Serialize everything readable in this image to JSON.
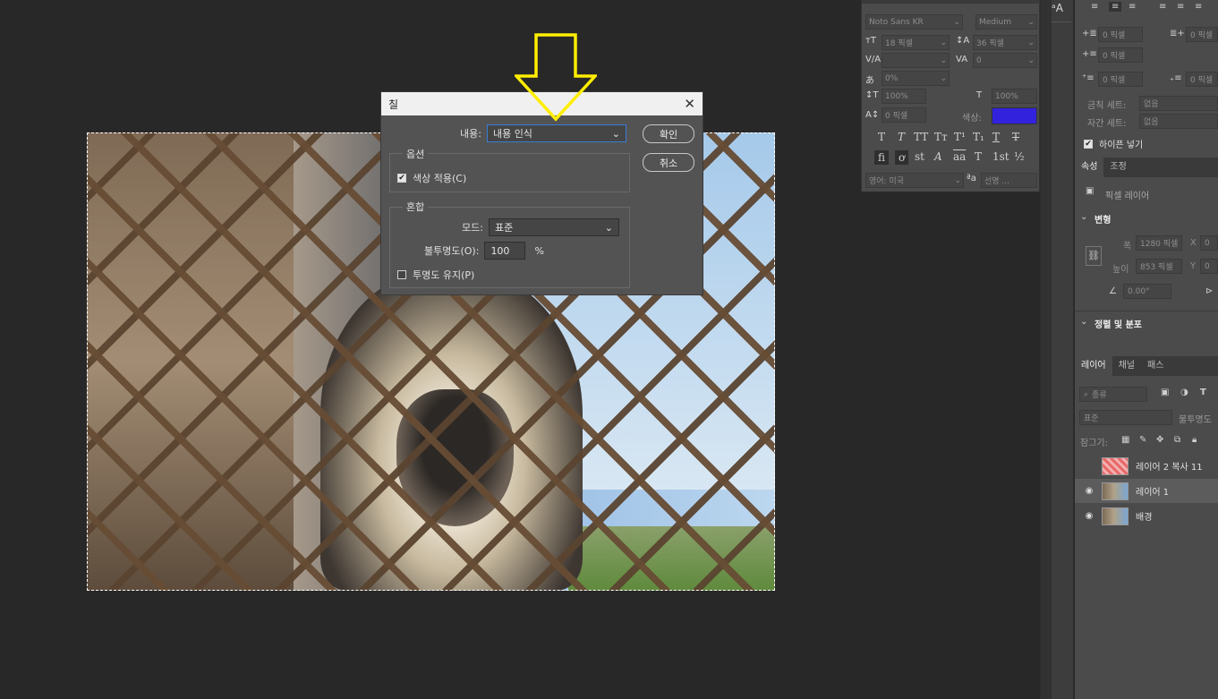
{
  "dialog": {
    "title": "칠",
    "close_glyph": "✕",
    "content_label": "내용:",
    "content_value": "내용 인식",
    "ok_label": "확인",
    "cancel_label": "취소",
    "options_label": "옵션",
    "color_adapt_label": "색상 적용(C)",
    "color_adapt_checked": true,
    "blend_label": "혼합",
    "mode_label": "모드:",
    "mode_value": "표준",
    "opacity_label": "불투명도(O):",
    "opacity_value": "100",
    "opacity_unit": "%",
    "preserve_label": "투명도 유지(P)",
    "preserve_checked": false
  },
  "character": {
    "font_family": "Noto Sans KR",
    "font_style": "Medium",
    "size": "18 픽셀",
    "leading": "36 픽셀",
    "kerning": "",
    "tracking": "0",
    "tsume": "0%",
    "vscale": "100%",
    "hscale": "100%",
    "baseline": "0 픽셀",
    "color_label": "색상:",
    "color_hex": "#3322dd",
    "language": "영어: 미국",
    "antialias": "선명 ...",
    "aa_glyph": "ªa"
  },
  "paragraph": {
    "indent_left": "0 픽셀",
    "indent_right": "0 픽셀",
    "indent_first": "0 픽셀",
    "space_before": "0 픽셀",
    "space_after": "0 픽셀",
    "kinsoku_label": "금칙 세트:",
    "kinsoku_value": "없음",
    "mojikumi_label": "자간 세트:",
    "mojikumi_value": "없음",
    "hyphenate_label": "하이픈 넣기",
    "hyphenate_checked": true
  },
  "properties": {
    "tab_properties": "속성",
    "tab_adjust": "조정",
    "pixel_layer_label": "픽셀 레이어",
    "transform_label": "변형",
    "width_label": "폭",
    "width_value": "1280 픽셀",
    "height_label": "높이",
    "height_value": "853 픽셀",
    "x_label": "X",
    "x_value": "0",
    "y_label": "Y",
    "y_value": "0",
    "angle_value": "0.00°",
    "align_label": "정렬 및 분포"
  },
  "layers": {
    "tab_layers": "레이어",
    "tab_channels": "채널",
    "tab_paths": "패스",
    "filter_label": "종류",
    "blend_mode": "표준",
    "opacity_label": "불투명도",
    "lock_label": "잠그기:",
    "items": [
      {
        "name": "레이어 2 복사 11",
        "visible": false
      },
      {
        "name": "레이어 1",
        "visible": true
      },
      {
        "name": "배경",
        "visible": true
      }
    ]
  },
  "colors": {
    "arrow": "#ffee00",
    "dialog_bg": "#535353",
    "panel_bg": "#4b4b4b"
  }
}
